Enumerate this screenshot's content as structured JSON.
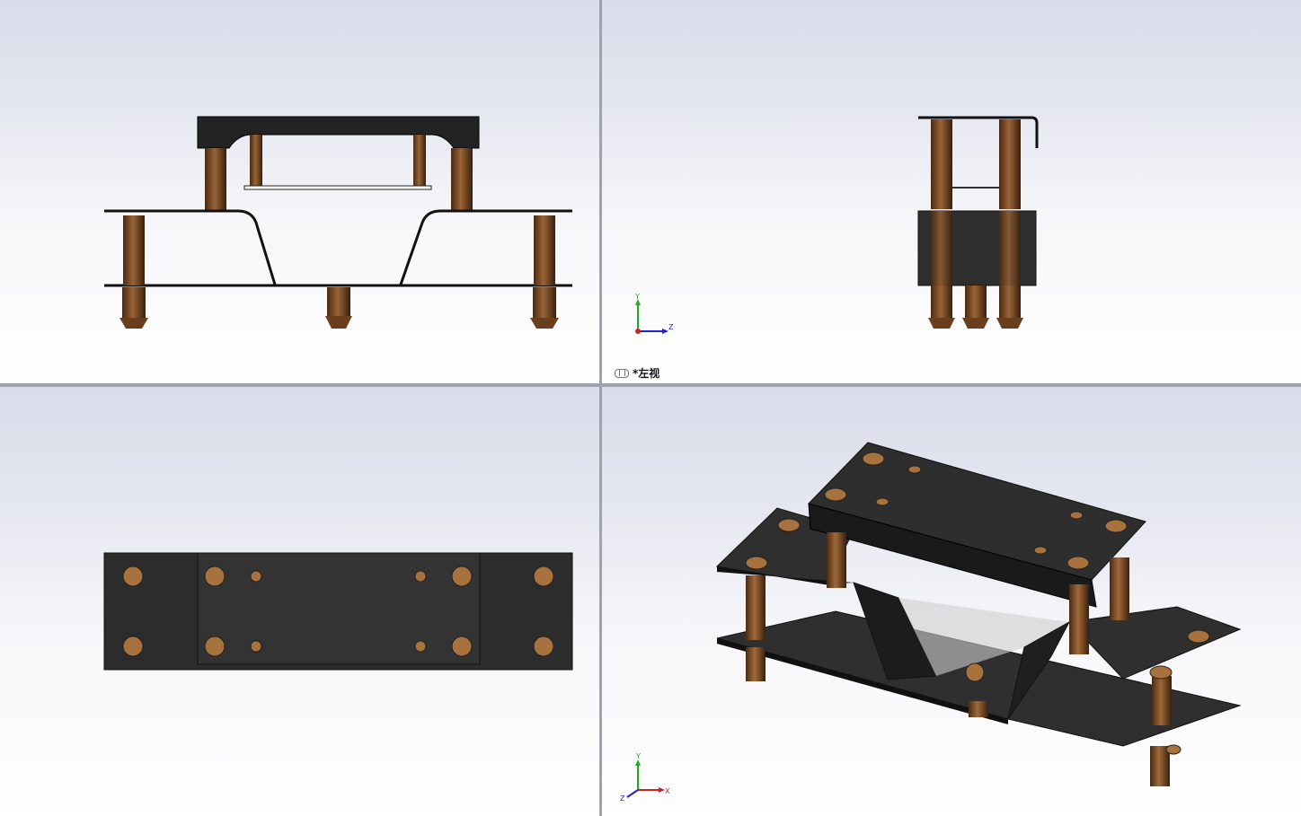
{
  "viewports": {
    "top_left": {
      "name": "front-view",
      "label": ""
    },
    "top_right": {
      "name": "left-view",
      "label": "*左视"
    },
    "bottom_left": {
      "name": "top-view",
      "label": ""
    },
    "bottom_right": {
      "name": "isometric-view",
      "label": ""
    }
  },
  "triad": {
    "x_label": "X",
    "y_label": "Y",
    "z_label": "Z"
  },
  "colors": {
    "steel": "#2b2b2b",
    "bronze": "#7a4a25",
    "bronze_light": "#b07a48",
    "background_top": "#d9dce9",
    "background_bottom": "#ffffff"
  }
}
